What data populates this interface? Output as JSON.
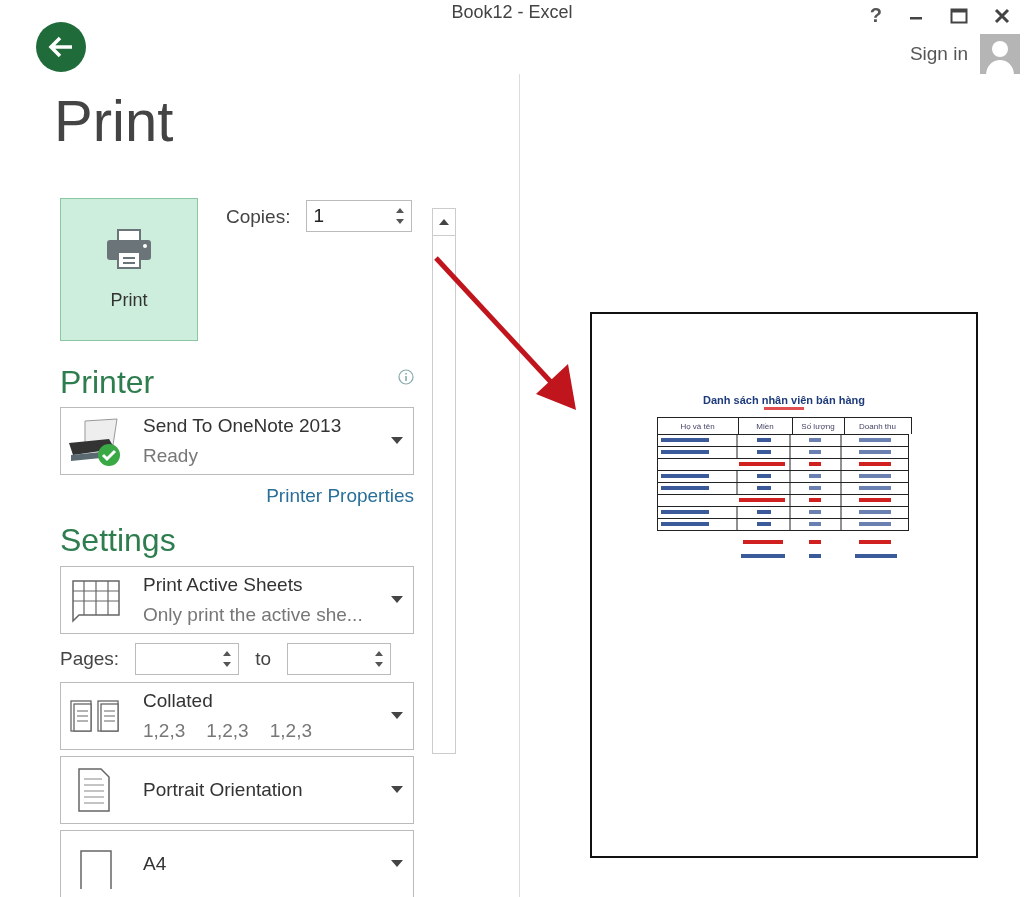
{
  "window": {
    "title": "Book12 - Excel",
    "help": "?",
    "sign_in": "Sign in"
  },
  "heading": "Print",
  "print_button": {
    "label": "Print"
  },
  "copies": {
    "label": "Copies:",
    "value": "1"
  },
  "printer": {
    "heading": "Printer",
    "name": "Send To OneNote 2013",
    "status": "Ready",
    "properties_link": "Printer Properties"
  },
  "settings": {
    "heading": "Settings",
    "pages_label": "Pages:",
    "to_label": "to",
    "items": [
      {
        "kind": "sheets",
        "title": "Print Active Sheets",
        "subtitle": "Only print the active she..."
      },
      {
        "kind": "collated",
        "title": "Collated",
        "subtitle": "1,2,3    1,2,3    1,2,3"
      },
      {
        "kind": "orientation",
        "title": "Portrait Orientation"
      },
      {
        "kind": "paper",
        "title": "A4"
      }
    ]
  },
  "preview": {
    "title": "Danh sách nhân viên bán hàng",
    "columns": [
      "Họ và tên",
      "Miền",
      "Số lượng",
      "Doanh thu"
    ]
  }
}
